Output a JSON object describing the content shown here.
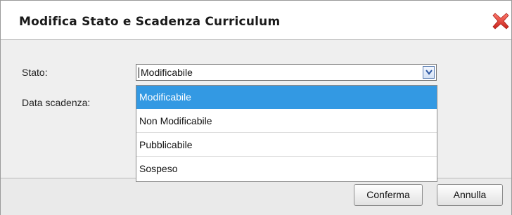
{
  "dialog": {
    "title": "Modifica Stato e Scadenza Curriculum",
    "close_icon": "close-x-icon"
  },
  "form": {
    "stato_label": "Stato:",
    "data_scadenza_label": "Data scadenza:",
    "stato_value": "Modificabile"
  },
  "dropdown": {
    "options": [
      {
        "label": "Modificabile",
        "selected": true
      },
      {
        "label": "Non Modificabile",
        "selected": false
      },
      {
        "label": "Pubblicabile",
        "selected": false
      },
      {
        "label": "Sospeso",
        "selected": false
      }
    ]
  },
  "footer": {
    "confirm_label": "Conferma",
    "cancel_label": "Annulla"
  },
  "colors": {
    "highlight": "#3399e3",
    "close_icon": "#e0362c"
  }
}
